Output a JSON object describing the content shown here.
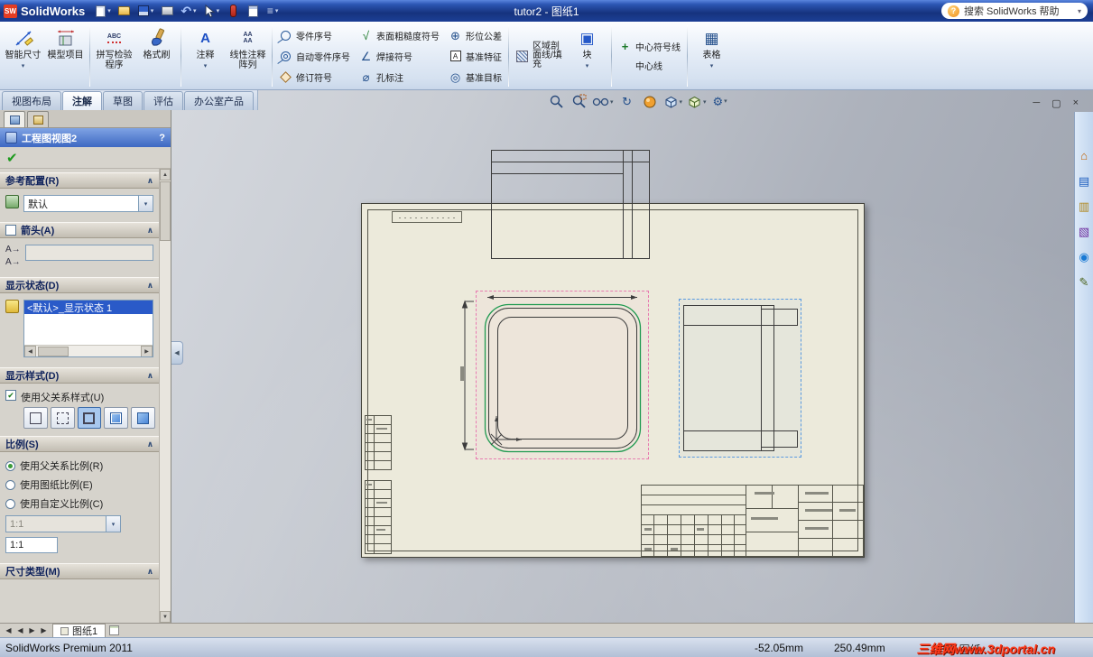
{
  "glyphs": {
    "dd": "▾",
    "chev": "∧",
    "undo": "↶",
    "menu": "≡",
    "min": "─",
    "restore": "▢",
    "close": "×",
    "left": "◀",
    "right": "▶",
    "up": "▲",
    "down": "▼",
    "help": "?",
    "check": "✔",
    "surface": "√",
    "weld": "∠",
    "hole": "⌀",
    "gdt": "⊕",
    "datum": "A",
    "target": "◎",
    "block": "▣",
    "centermark": "+",
    "centerline": "¦",
    "table": "▦",
    "note": "A",
    "pattern": "AA",
    "abc": "ABC",
    "home": "⌂",
    "library": "▤",
    "explorer": "▥",
    "palette": "▧",
    "appearance": "◉",
    "props": "✎",
    "refresh": "↻",
    "gear": "⚙"
  },
  "titlebar": {
    "logo_mark": "SW",
    "app": "SolidWorks",
    "doc": "tutor2 - 图纸1",
    "search": "搜索 SolidWorks 帮助"
  },
  "ribbon": {
    "tabs": [
      {
        "label": "视图布局"
      },
      {
        "label": "注解"
      },
      {
        "label": "草图"
      },
      {
        "label": "评估"
      },
      {
        "label": "办公室产品"
      }
    ],
    "large": [
      {
        "label": "智能尺寸"
      },
      {
        "label": "模型项目"
      },
      {
        "label": "拼写检验程序"
      },
      {
        "label": "格式刷"
      },
      {
        "label": "注释"
      },
      {
        "label": "线性注释阵列"
      }
    ],
    "small": [
      {
        "label": "零件序号"
      },
      {
        "label": "自动零件序号"
      },
      {
        "label": "修订符号"
      },
      {
        "label": "表面粗糙度符号"
      },
      {
        "label": "焊接符号"
      },
      {
        "label": "孔标注"
      },
      {
        "label": "形位公差"
      },
      {
        "label": "基准特征"
      },
      {
        "label": "基准目标"
      }
    ],
    "hatch": {
      "label": "区域剖面线/填充"
    },
    "block": {
      "label": "块"
    },
    "center_mark": {
      "label": "中心符号线"
    },
    "centerline": {
      "label": "中心线"
    },
    "table": {
      "label": "表格"
    }
  },
  "pm": {
    "title": "工程图视图2",
    "sections": {
      "ref": {
        "label": "参考配置(R)",
        "value": "默认"
      },
      "arrow": {
        "label": "箭头(A)",
        "opt": "A→"
      },
      "state": {
        "label": "显示状态(D)",
        "selected": "<默认>_显示状态 1"
      },
      "style": {
        "label": "显示样式(D)",
        "checkbox": "使用父关系样式(U)"
      },
      "scale": {
        "label": "比例(S)",
        "r1": "使用父关系比例(R)",
        "r2": "使用图纸比例(E)",
        "r3": "使用自定义比例(C)",
        "combo": "1:1",
        "custom": "1:1"
      },
      "dimtype": {
        "label": "尺寸类型(M)"
      }
    }
  },
  "sheetbar": {
    "tab": "图纸1"
  },
  "status": {
    "product": "SolidWorks Premium 2011",
    "x": "-52.05mm",
    "y": "250.49mm",
    "edit": "编辑: 图纸",
    "watermark": "三维网www.3dportal.cn"
  }
}
